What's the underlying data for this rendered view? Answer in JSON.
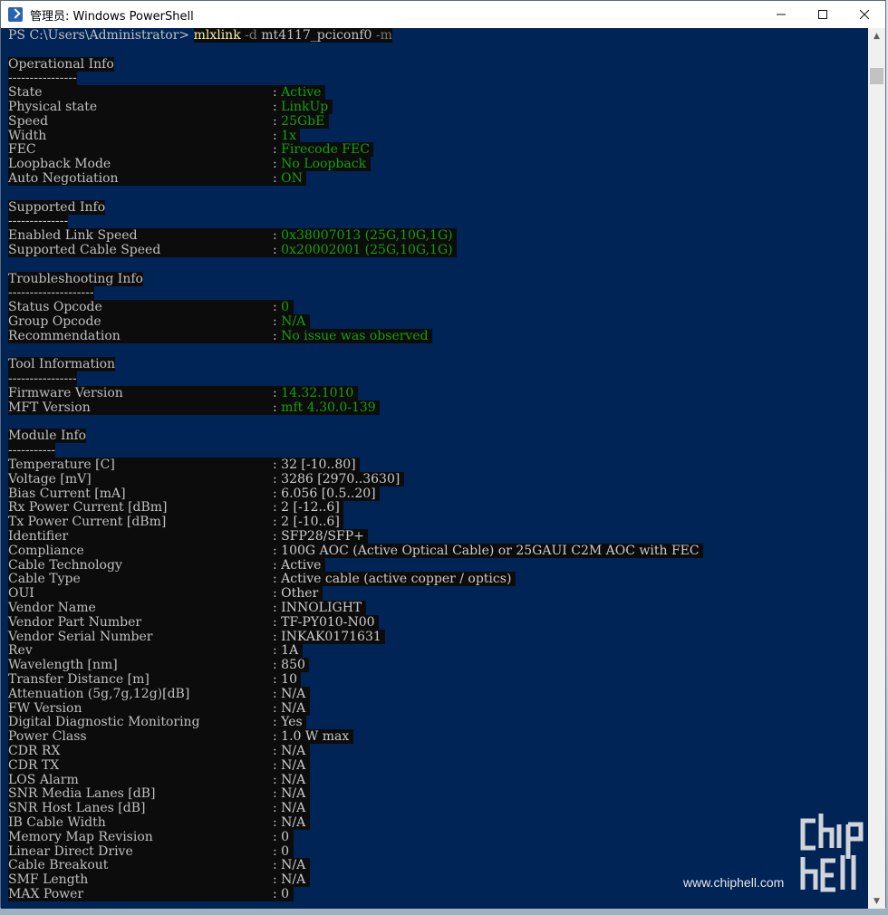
{
  "window": {
    "title": "管理员: Windows PowerShell",
    "minimize_icon": "minimize-icon",
    "maximize_icon": "maximize-icon",
    "close_icon": "close-icon"
  },
  "prompt": {
    "path": "PS C:\\Users\\Administrator> ",
    "command": "mlxlink",
    "arg1": " -d ",
    "arg2": "mt4117_pciconf0",
    "arg3": " -m"
  },
  "sections": {
    "operational": {
      "title": "Operational Info",
      "underline": "----------------",
      "rows": [
        {
          "label": "State",
          "value": "Active"
        },
        {
          "label": "Physical state",
          "value": "LinkUp"
        },
        {
          "label": "Speed",
          "value": "25GbE"
        },
        {
          "label": "Width",
          "value": "1x"
        },
        {
          "label": "FEC",
          "value": "Firecode FEC"
        },
        {
          "label": "Loopback Mode",
          "value": "No Loopback"
        },
        {
          "label": "Auto Negotiation",
          "value": "ON"
        }
      ]
    },
    "supported": {
      "title": "Supported Info",
      "underline": "--------------",
      "rows": [
        {
          "label": "Enabled Link Speed",
          "value": "0x38007013 (25G,10G,1G)"
        },
        {
          "label": "Supported Cable Speed",
          "value": "0x20002001 (25G,10G,1G)"
        }
      ]
    },
    "troubleshooting": {
      "title": "Troubleshooting Info",
      "underline": "--------------------",
      "rows": [
        {
          "label": "Status Opcode",
          "value": "0"
        },
        {
          "label": "Group Opcode",
          "value": "N/A"
        },
        {
          "label": "Recommendation",
          "value": "No issue was observed"
        }
      ]
    },
    "tool": {
      "title": "Tool Information",
      "underline": "----------------",
      "rows": [
        {
          "label": "Firmware Version",
          "value": "14.32.1010"
        },
        {
          "label": "MFT Version",
          "value": "mft 4.30.0-139"
        }
      ]
    },
    "module": {
      "title": "Module Info",
      "underline": "-----------",
      "rows": [
        {
          "label": "Temperature [C]",
          "value": "32 [-10..80]"
        },
        {
          "label": "Voltage [mV]",
          "value": "3286 [2970..3630]"
        },
        {
          "label": "Bias Current [mA]",
          "value": "6.056 [0.5..20]"
        },
        {
          "label": "Rx Power Current [dBm]",
          "value": "2 [-12..6]"
        },
        {
          "label": "Tx Power Current [dBm]",
          "value": "2 [-10..6]"
        },
        {
          "label": "Identifier",
          "value": "SFP28/SFP+"
        },
        {
          "label": "Compliance",
          "value": "100G AOC (Active Optical Cable) or 25GAUI C2M AOC with FEC"
        },
        {
          "label": "Cable Technology",
          "value": "Active"
        },
        {
          "label": "Cable Type",
          "value": "Active cable (active copper / optics)"
        },
        {
          "label": "OUI",
          "value": "Other"
        },
        {
          "label": "Vendor Name",
          "value": "INNOLIGHT"
        },
        {
          "label": "Vendor Part Number",
          "value": "TF-PY010-N00"
        },
        {
          "label": "Vendor Serial Number",
          "value": "INKAK0171631"
        },
        {
          "label": "Rev",
          "value": "1A"
        },
        {
          "label": "Wavelength [nm]",
          "value": "850"
        },
        {
          "label": "Transfer Distance [m]",
          "value": "10"
        },
        {
          "label": "Attenuation (5g,7g,12g)[dB]",
          "value": "N/A"
        },
        {
          "label": "FW Version",
          "value": "N/A"
        },
        {
          "label": "Digital Diagnostic Monitoring",
          "value": "Yes"
        },
        {
          "label": "Power Class",
          "value": "1.0 W max"
        },
        {
          "label": "CDR RX",
          "value": "N/A"
        },
        {
          "label": "CDR TX",
          "value": "N/A"
        },
        {
          "label": "LOS Alarm",
          "value": "N/A"
        },
        {
          "label": "SNR Media Lanes [dB]",
          "value": "N/A"
        },
        {
          "label": "SNR Host Lanes [dB]",
          "value": "N/A"
        },
        {
          "label": "IB Cable Width",
          "value": "N/A"
        },
        {
          "label": "Memory Map Revision",
          "value": "0"
        },
        {
          "label": "Linear Direct Drive",
          "value": "0"
        },
        {
          "label": "Cable Breakout",
          "value": "N/A"
        },
        {
          "label": "SMF Length",
          "value": "N/A"
        },
        {
          "label": "MAX Power",
          "value": "0"
        }
      ]
    }
  },
  "separator": ": ",
  "watermark": {
    "site": "www.chiphell.com",
    "logo_text": "chip hell"
  },
  "colors": {
    "console_bg": "#012456",
    "highlight_bg": "#0c0c0c",
    "green": "#13a10e",
    "text": "#c0c0c0"
  }
}
